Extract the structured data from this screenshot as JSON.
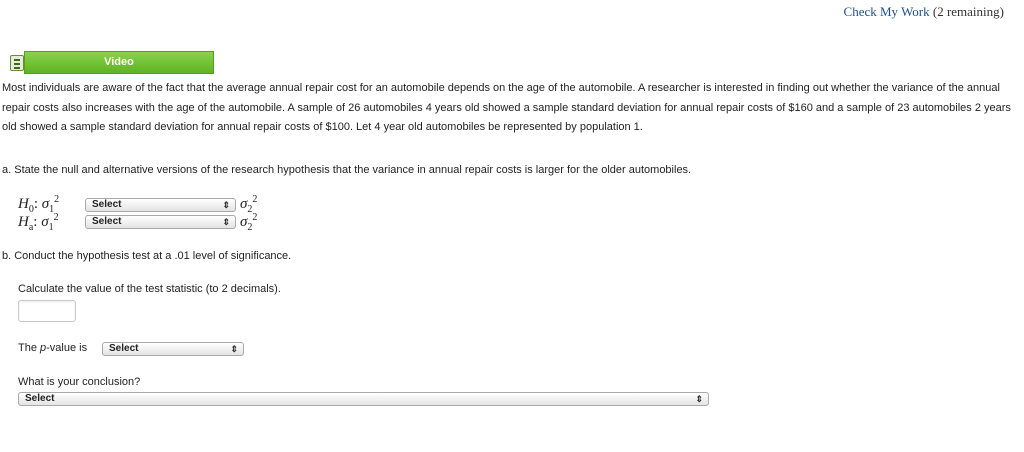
{
  "header": {
    "check_link_label": "Check My Work",
    "remaining": "(2 remaining)"
  },
  "video": {
    "label": "Video",
    "icon": "film-icon"
  },
  "problem": {
    "intro": "Most individuals are aware of the fact that the average annual repair cost for an automobile depends on the age of the automobile. A researcher is interested in finding out whether the variance of the annual repair costs also increases with the age of the automobile. A sample of 26 automobiles 4 years old showed a sample standard deviation for annual repair costs of $160 and a sample of 23 automobiles 2 years old showed a sample standard deviation for annual repair costs of $100. Let 4 year old automobiles be represented by population 1.",
    "part_a": "a. State the null and alternative versions of the research hypothesis that the variance in annual repair costs is larger for the older automobiles.",
    "h0": {
      "H": "H",
      "sub": "0",
      "colon": ":",
      "sigma1": "σ",
      "sub1": "1",
      "sup1": "2",
      "select": "Select",
      "sigma2": "σ",
      "sub2": "2",
      "sup2": "2"
    },
    "ha": {
      "H": "H",
      "sub": "a",
      "colon": ":",
      "sigma1": "σ",
      "sub1": "1",
      "sup1": "2",
      "select": "Select",
      "sigma2": "σ",
      "sub2": "2",
      "sup2": "2"
    },
    "part_b": "b. Conduct the hypothesis test at a .01 level of significance.",
    "calc_label": "Calculate the value of the test statistic (to 2 decimals).",
    "test_stat_value": "",
    "pvalue_prefix": "The ",
    "pvalue_p": "p",
    "pvalue_suffix": "-value is",
    "pvalue_select": "Select",
    "conclusion_label": "What is your conclusion?",
    "conclusion_select": "Select"
  },
  "icons": {
    "select_arrow": "⇕"
  }
}
